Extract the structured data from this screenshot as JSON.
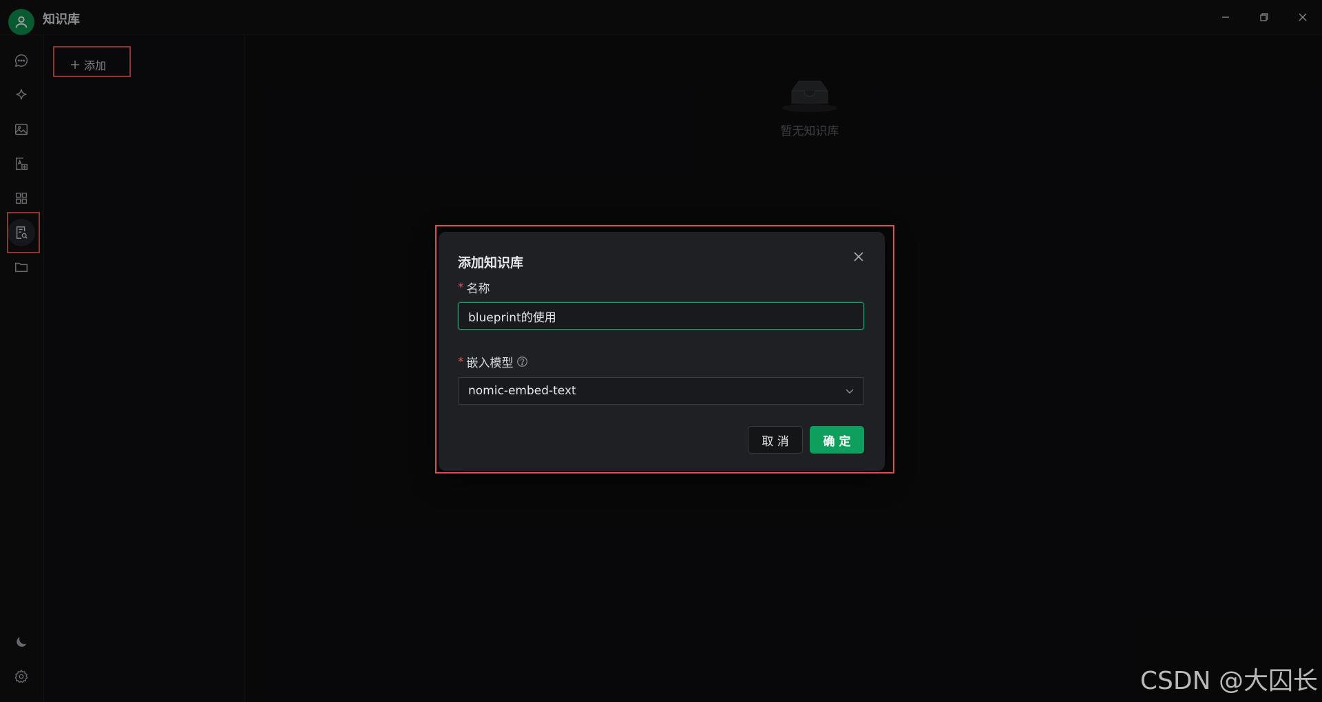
{
  "app": {
    "title": "知识库"
  },
  "sidebar": {
    "items": [
      {
        "name": "chat",
        "icon": "chat-bubble-icon"
      },
      {
        "name": "assistant",
        "icon": "sparkle-icon"
      },
      {
        "name": "image",
        "icon": "image-icon"
      },
      {
        "name": "translate",
        "icon": "translate-icon"
      },
      {
        "name": "apps",
        "icon": "grid-icon"
      },
      {
        "name": "knowledge",
        "icon": "doc-search-icon",
        "active": true
      },
      {
        "name": "files",
        "icon": "folder-icon"
      }
    ],
    "bottom": [
      {
        "name": "theme",
        "icon": "moon-icon"
      },
      {
        "name": "settings",
        "icon": "gear-icon"
      }
    ]
  },
  "list_panel": {
    "add_label": "添加"
  },
  "main": {
    "empty_text": "暂无知识库"
  },
  "dialog": {
    "title": "添加知识库",
    "name_label": "名称",
    "name_value": "blueprint的使用",
    "model_label": "嵌入模型",
    "model_value": "nomic-embed-text",
    "required_mark": "*",
    "cancel_label": "取 消",
    "ok_label": "确 定"
  },
  "watermark": "CSDN @大囚长",
  "colors": {
    "accent": "#0e9e5d",
    "highlight": "#d9534f",
    "background": "#101012"
  }
}
